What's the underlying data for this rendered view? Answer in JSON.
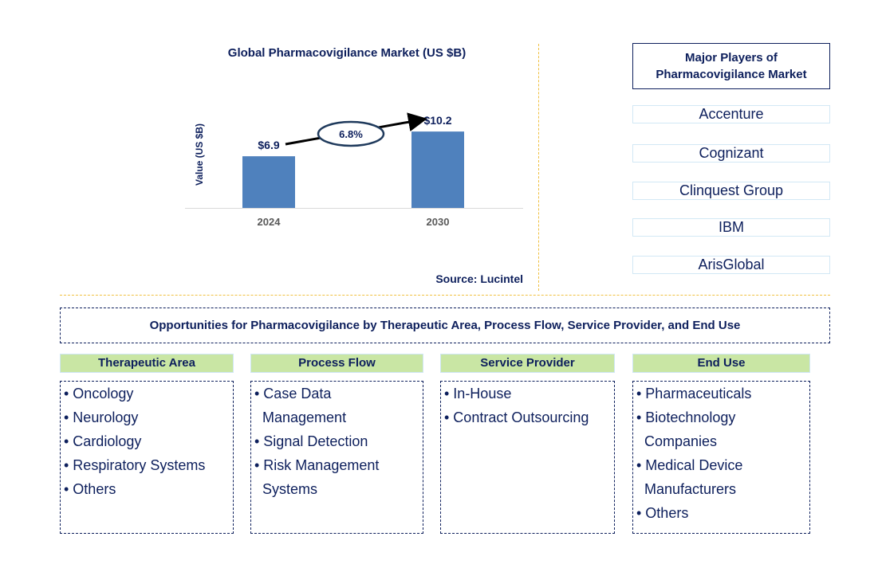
{
  "chart_data": {
    "type": "bar",
    "title": "Global Pharmacovigilance Market (US $B)",
    "ylabel": "Value (US $B)",
    "categories": [
      "2024",
      "2030"
    ],
    "values": [
      6.9,
      10.2
    ],
    "data_labels": [
      "$6.9",
      "$10.2"
    ],
    "annotation": "6.8%",
    "bar_color": "#4f81bd",
    "source": "Source: Lucintel"
  },
  "players": {
    "title": "Major Players of Pharmacovigilance Market",
    "items": [
      "Accenture",
      "Cognizant",
      "Clinquest Group",
      "IBM",
      "ArisGlobal"
    ]
  },
  "opportunities": {
    "title": "Opportunities for Pharmacovigilance by Therapeutic Area, Process Flow, Service Provider, and End Use",
    "columns": [
      {
        "header": "Therapeutic Area",
        "lines": [
          "• Oncology",
          "• Neurology",
          "• Cardiology",
          "• Respiratory Systems",
          "• Others"
        ]
      },
      {
        "header": "Process Flow",
        "lines": [
          "• Case Data",
          "  Management",
          "• Signal Detection",
          "• Risk Management",
          "  Systems"
        ]
      },
      {
        "header": "Service Provider",
        "lines": [
          "• In-House",
          "• Contract Outsourcing"
        ]
      },
      {
        "header": "End Use",
        "lines": [
          "• Pharmaceuticals",
          "• Biotechnology",
          "  Companies",
          "• Medical Device",
          "  Manufacturers",
          "• Others"
        ]
      }
    ]
  }
}
